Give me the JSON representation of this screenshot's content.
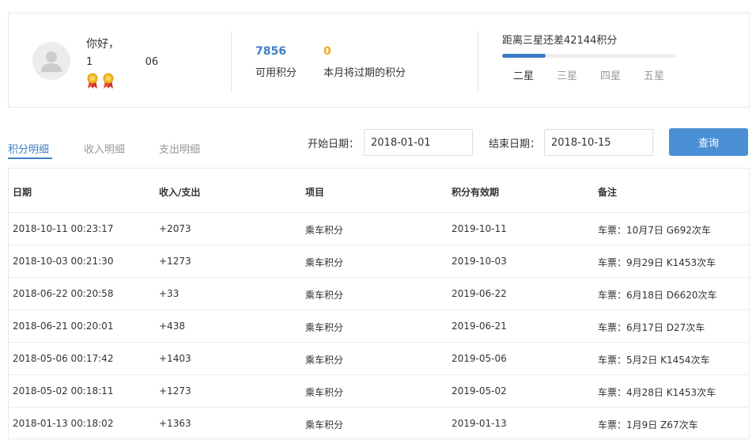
{
  "profile": {
    "greeting": "你好，",
    "user_id_prefix": "1",
    "user_id_suffix": "06",
    "medal_icon": "medal-icon"
  },
  "points": {
    "available_value": "7856",
    "available_label": "可用积分",
    "expiring_value": "0",
    "expiring_label": "本月将过期的积分",
    "available_color": "#3d7dc8",
    "expiring_color": "#f5a623"
  },
  "level": {
    "remain_text": "距离三星还差42144积分",
    "progress_fraction": 0.25,
    "items": [
      "二星",
      "三星",
      "四星",
      "五星"
    ],
    "active_index": 0
  },
  "tabs": [
    "积分明细",
    "收入明细",
    "支出明细"
  ],
  "filter": {
    "start_label": "开始日期：",
    "start_value": "2018-01-01",
    "end_label": "结束日期：",
    "end_value": "2018-10-15",
    "query_label": "查询"
  },
  "table": {
    "headers": [
      "日期",
      "收入/支出",
      "项目",
      "积分有效期",
      "备注"
    ],
    "rows": [
      [
        "2018-10-11 00:23:17",
        "+2073",
        "乘车积分",
        "2019-10-11",
        "车票：10月7日 G692次车"
      ],
      [
        "2018-10-03 00:21:30",
        "+1273",
        "乘车积分",
        "2019-10-03",
        "车票：9月29日 K1453次车"
      ],
      [
        "2018-06-22 00:20:58",
        "+33",
        "乘车积分",
        "2019-06-22",
        "车票：6月18日 D6620次车"
      ],
      [
        "2018-06-21 00:20:01",
        "+438",
        "乘车积分",
        "2019-06-21",
        "车票：6月17日 D27次车"
      ],
      [
        "2018-05-06 00:17:42",
        "+1403",
        "乘车积分",
        "2019-05-06",
        "车票：5月2日 K1454次车"
      ],
      [
        "2018-05-02 00:18:11",
        "+1273",
        "乘车积分",
        "2019-05-02",
        "车票：4月28日 K1453次车"
      ],
      [
        "2018-01-13 00:18:02",
        "+1363",
        "乘车积分",
        "2019-01-13",
        "车票：1月9日 Z67次车"
      ]
    ]
  }
}
